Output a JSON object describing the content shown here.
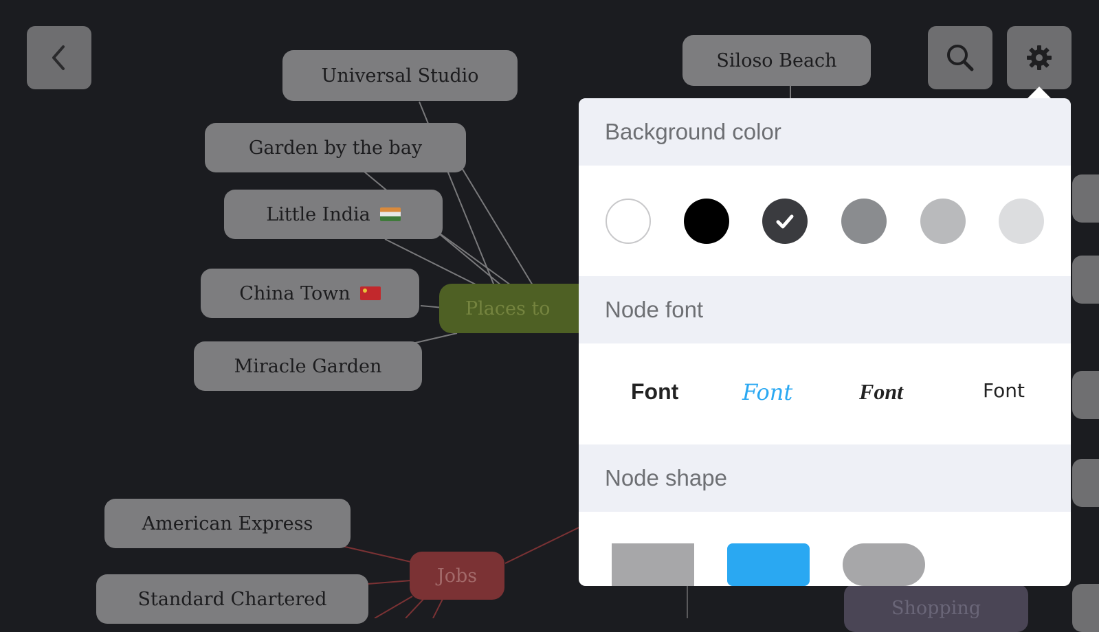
{
  "mindmap": {
    "nodes": {
      "universal_studio": "Universal Studio",
      "garden_by_the_bay": "Garden by the bay",
      "little_india": "Little India",
      "china_town": "China Town",
      "miracle_garden": "Miracle Garden",
      "places_to": "Places to",
      "siloso_beach": "Siloso Beach",
      "american_express": "American Express",
      "standard_chartered": "Standard Chartered",
      "jobs": "Jobs",
      "shopping": "Shopping"
    }
  },
  "toolbar": {
    "back_icon": "chevron-left-icon",
    "search_icon": "search-icon",
    "settings_icon": "gear-icon"
  },
  "settings_popover": {
    "background_color": {
      "header": "Background color",
      "swatches": [
        "#ffffff",
        "#000000",
        "#3a3b3f",
        "#8a8c8f",
        "#b9babc",
        "#dcdddf"
      ],
      "selected_index": 2
    },
    "node_font": {
      "header": "Node font",
      "options": [
        "Font",
        "Font",
        "Font",
        "Font"
      ],
      "selected_index": 1
    },
    "node_shape": {
      "header": "Node shape",
      "options": [
        "rectangle",
        "rounded-rectangle",
        "pill"
      ],
      "selected_index": 1
    },
    "accent_color": "#2aa8f2"
  }
}
